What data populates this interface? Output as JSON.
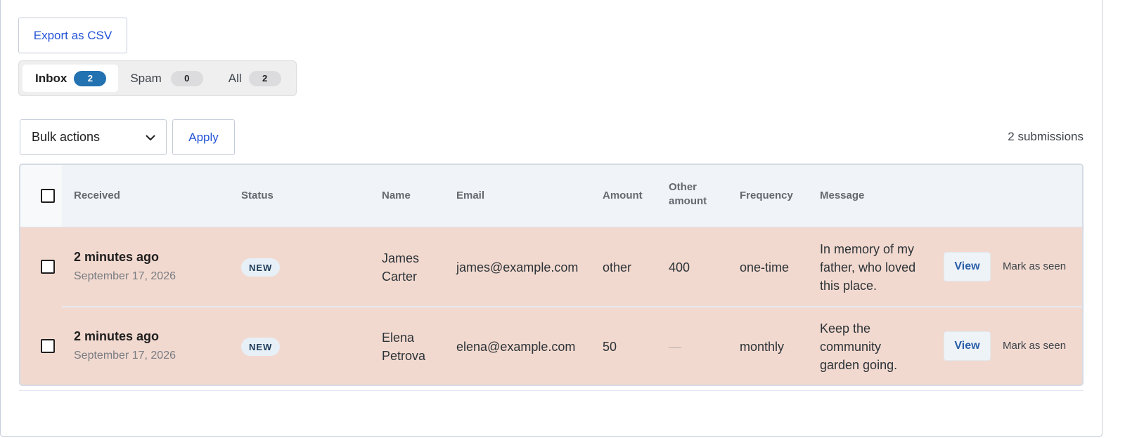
{
  "toolbar": {
    "export_label": "Export as CSV",
    "bulk_label": "Bulk actions",
    "apply_label": "Apply",
    "count_text": "2 submissions"
  },
  "tabs": [
    {
      "label": "Inbox",
      "count": "2",
      "active": true
    },
    {
      "label": "Spam",
      "count": "0",
      "active": false
    },
    {
      "label": "All",
      "count": "2",
      "active": false
    }
  ],
  "table": {
    "columns": [
      "Received",
      "Status",
      "Name",
      "Email",
      "Amount",
      "Other amount",
      "Frequency",
      "Message"
    ],
    "rows": [
      {
        "received": "2 minutes ago",
        "date": "September 17, 2026",
        "status": "NEW",
        "name": "James Carter",
        "email": "james@example.com",
        "amount": "other",
        "other_amount": "400",
        "frequency": "one-time",
        "message": "In memory of my father, who loved this place.",
        "view_label": "View",
        "seen_label": "Mark as seen"
      },
      {
        "received": "2 minutes ago",
        "date": "September 17, 2026",
        "status": "NEW",
        "name": "Elena Petrova",
        "email": "elena@example.com",
        "amount": "50",
        "other_amount": "—",
        "frequency": "monthly",
        "message": "Keep the community garden going.",
        "view_label": "View",
        "seen_label": "Mark as seen"
      }
    ]
  },
  "colors": {
    "accent": "#2271b1",
    "row_highlight": "#f2d9cf",
    "header_bg": "#f0f3f7",
    "link": "#2454d6"
  },
  "icons": {
    "bulk_dropdown": "chevron-down-icon"
  }
}
